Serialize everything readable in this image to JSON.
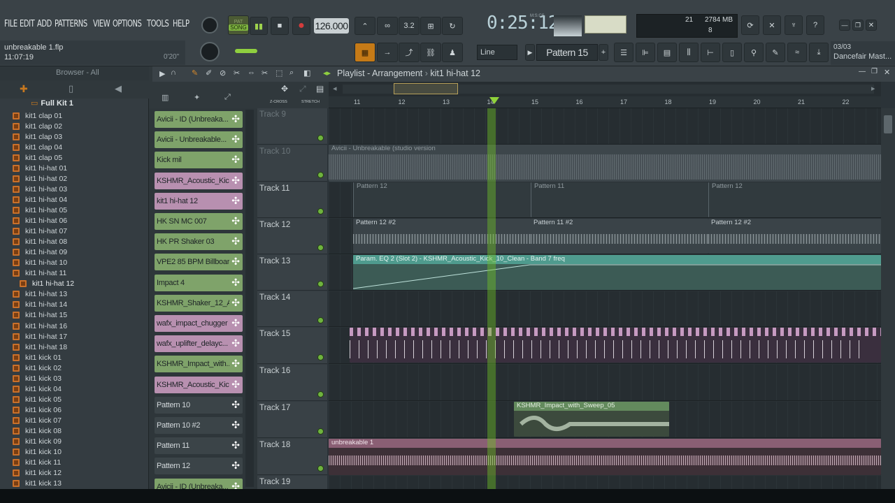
{
  "menu": [
    "FILE",
    "EDIT",
    "ADD",
    "PATTERNS",
    "VIEW",
    "OPTIONS",
    "TOOLS",
    "HELP"
  ],
  "song": {
    "file": "unbreakable 1.flp",
    "clock": "11:07:19",
    "position": "0'20\""
  },
  "transport": {
    "mode": "SONG",
    "pat_label": "PAT",
    "tempo": "126.000",
    "time": "0:25:12",
    "time_label": "M:S:CS"
  },
  "cpu": {
    "mem": "2784 MB",
    "voices": "21",
    "polyphony": "8"
  },
  "tools": {
    "snap": "Line",
    "pattern": "Pattern 15"
  },
  "hint": {
    "line1": "03/03",
    "line2": "Dancefair Mast..."
  },
  "browser": {
    "title": "Browser - All",
    "root": "Full Kit 1",
    "items": [
      "kit1 clap 01",
      "kit1 clap 02",
      "kit1 clap 03",
      "kit1 clap 04",
      "kit1 clap 05",
      "kit1 hi-hat 01",
      "kit1 hi-hat 02",
      "kit1 hi-hat 03",
      "kit1 hi-hat 04",
      "kit1 hi-hat 05",
      "kit1 hi-hat 06",
      "kit1 hi-hat 07",
      "kit1 hi-hat 08",
      "kit1 hi-hat 09",
      "kit1 hi-hat 10",
      "kit1 hi-hat 11",
      "kit1 hi-hat 12",
      "kit1 hi-hat 13",
      "kit1 hi-hat 14",
      "kit1 hi-hat 15",
      "kit1 hi-hat 16",
      "kit1 hi-hat 17",
      "kit1 hi-hat 18",
      "kit1 kick 01",
      "kit1 kick 02",
      "kit1 kick 03",
      "kit1 kick 04",
      "kit1 kick 05",
      "kit1 kick 06",
      "kit1 kick 07",
      "kit1 kick 08",
      "kit1 kick 09",
      "kit1 kick 10",
      "kit1 kick 11",
      "kit1 kick 12",
      "kit1 kick 13"
    ],
    "selected_index": 16
  },
  "channels": [
    {
      "name": "Avicii - ID (Unbreaka...",
      "color": "g"
    },
    {
      "name": "Avicii - Unbreakable...",
      "color": "g"
    },
    {
      "name": "Kick mil",
      "color": "g"
    },
    {
      "name": "KSHMR_Acoustic_Kic...",
      "color": "p"
    },
    {
      "name": "kit1 hi-hat 12",
      "color": "p"
    },
    {
      "name": "HK SN MC 007",
      "color": "g"
    },
    {
      "name": "HK PR Shaker 03",
      "color": "g"
    },
    {
      "name": "VPE2 85 BPM Billboar...",
      "color": "g"
    },
    {
      "name": "Impact 4",
      "color": "g"
    },
    {
      "name": "KSHMR_Shaker_12_A",
      "color": "g"
    },
    {
      "name": "wafx_impact_chugger",
      "color": "p"
    },
    {
      "name": "wafx_uplifter_delayc...",
      "color": "p"
    },
    {
      "name": "KSHMR_Impact_with...",
      "color": "g"
    },
    {
      "name": "KSHMR_Acoustic_Kic...",
      "color": "p"
    },
    {
      "name": "Pattern 10",
      "color": "d"
    },
    {
      "name": "Pattern 10 #2",
      "color": "d"
    },
    {
      "name": "Pattern 11",
      "color": "d"
    },
    {
      "name": "Pattern 12",
      "color": "d"
    },
    {
      "name": "Avicii - ID (Unbreaka...",
      "color": "g"
    }
  ],
  "playlist": {
    "title": "Playlist - Arrangement",
    "pattern_crumb": "kit1 hi-hat 12",
    "zcross": "Z-CROSS",
    "stretch": "STRETCH",
    "ruler": [
      "11",
      "12",
      "13",
      "14",
      "15",
      "16",
      "17",
      "18",
      "19",
      "20",
      "21",
      "22"
    ],
    "tracks": [
      "Track 9",
      "Track 10",
      "Track 11",
      "Track 12",
      "Track 13",
      "Track 14",
      "Track 15",
      "Track 16",
      "Track 17",
      "Track 18",
      "Track 19"
    ],
    "clips": {
      "t10": "Avicii - Unbreakable (studio version",
      "t11a": "Pattern 12",
      "t11b": "Pattern 11",
      "t11c": "Pattern 12",
      "t12a": "Pattern 12 #2",
      "t12b": "Pattern 11 #2",
      "t12c": "Pattern 12 #2",
      "t13": "Param. EQ 2 (Slot 2) - KSHMR_Acoustic_Kick_10_Clean - Band 7 freq",
      "t17": "KSHMR_Impact_with_Sweep_05",
      "t18": "unbreakable 1"
    }
  }
}
